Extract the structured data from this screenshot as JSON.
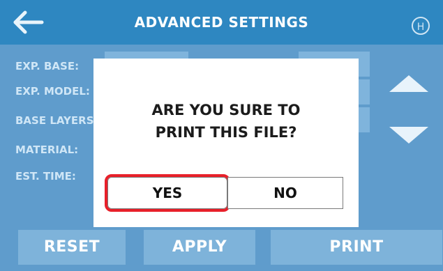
{
  "header": {
    "title": "ADVANCED SETTINGS",
    "back_icon": "back-arrow-icon",
    "home_icon_letter": "H"
  },
  "settings": {
    "labels": [
      "EXP. BASE:",
      "EXP. MODEL:",
      "BASE LAYERS",
      "MATERIAL:",
      "EST. TIME:"
    ]
  },
  "scroll": {
    "up_icon": "triangle-up-icon",
    "down_icon": "triangle-down-icon"
  },
  "actions": {
    "reset": "RESET",
    "apply": "APPLY",
    "print": "PRINT"
  },
  "dialog": {
    "line1": "ARE YOU SURE TO",
    "line2": "PRINT THIS FILE?",
    "yes": "YES",
    "no": "NO"
  },
  "colors": {
    "background": "#5f9ccc",
    "header": "#2e87c1",
    "highlight": "#e8202a"
  }
}
